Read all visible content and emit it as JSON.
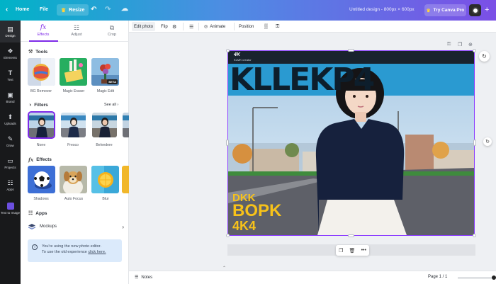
{
  "topbar": {
    "home": "Home",
    "file": "File",
    "resize": "Resize",
    "title": "Untitled design - 800px × 600px",
    "try_pro": "Try Canva Pro"
  },
  "rail": [
    {
      "label": "Design",
      "icon": "layout-icon"
    },
    {
      "label": "Elements",
      "icon": "shapes-icon"
    },
    {
      "label": "Text",
      "icon": "text-icon"
    },
    {
      "label": "Brand",
      "icon": "brand-icon"
    },
    {
      "label": "Uploads",
      "icon": "upload-icon"
    },
    {
      "label": "Draw",
      "icon": "pen-icon"
    },
    {
      "label": "Projects",
      "icon": "folder-icon"
    },
    {
      "label": "Apps",
      "icon": "apps-icon"
    },
    {
      "label": "Text to Image",
      "icon": "text-to-image-icon"
    }
  ],
  "panel": {
    "tabs": [
      {
        "label": "Effects",
        "icon": "fx-icon"
      },
      {
        "label": "Adjust",
        "icon": "sliders-icon"
      },
      {
        "label": "Crop",
        "icon": "crop-icon"
      }
    ],
    "tools": {
      "heading": "Tools",
      "items": [
        {
          "label": "BG Remover"
        },
        {
          "label": "Magic Eraser"
        },
        {
          "label": "Magic Edit",
          "badge": "BETA"
        }
      ]
    },
    "filters": {
      "heading": "Filters",
      "see_all": "See all",
      "items": [
        {
          "label": "None"
        },
        {
          "label": "Fresco"
        },
        {
          "label": "Belvedere"
        }
      ]
    },
    "effects": {
      "heading": "Effects",
      "items": [
        {
          "label": "Shadows"
        },
        {
          "label": "Auto Focus"
        },
        {
          "label": "Blur"
        }
      ]
    },
    "apps": {
      "heading": "Apps",
      "item": "Mockups"
    },
    "notice": {
      "line1": "You're using the new photo editor.",
      "line2": "To use the old experience ",
      "link": "click here."
    }
  },
  "context_toolbar": {
    "edit_photo": "Edit photo",
    "flip": "Flip",
    "animate": "Animate",
    "position": "Position"
  },
  "design": {
    "logo_text": "4K",
    "logo_sub": "KLMK·creator",
    "big_title": "KLLEKP4",
    "bottom_line1": "DKK",
    "bottom_line2": "BOPK",
    "bottom_line3": "4K4"
  },
  "bottombar": {
    "notes": "Notes",
    "page": "Page 1 / 1"
  }
}
